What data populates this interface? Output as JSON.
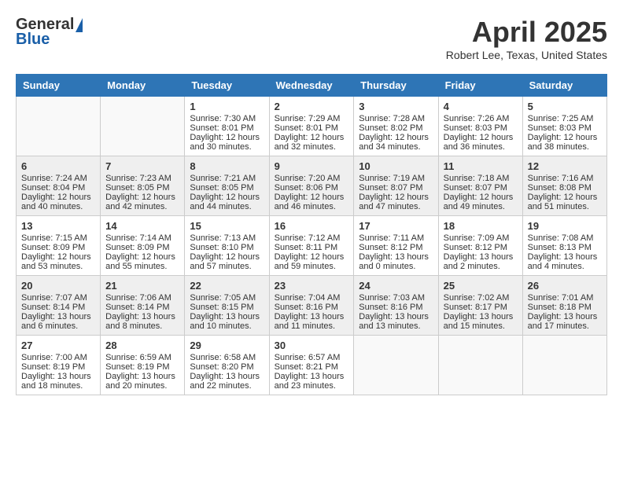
{
  "header": {
    "logo_general": "General",
    "logo_blue": "Blue",
    "month_title": "April 2025",
    "location": "Robert Lee, Texas, United States"
  },
  "days_of_week": [
    "Sunday",
    "Monday",
    "Tuesday",
    "Wednesday",
    "Thursday",
    "Friday",
    "Saturday"
  ],
  "weeks": [
    [
      {
        "day": "",
        "sunrise": "",
        "sunset": "",
        "daylight": ""
      },
      {
        "day": "",
        "sunrise": "",
        "sunset": "",
        "daylight": ""
      },
      {
        "day": "1",
        "sunrise": "Sunrise: 7:30 AM",
        "sunset": "Sunset: 8:01 PM",
        "daylight": "Daylight: 12 hours and 30 minutes."
      },
      {
        "day": "2",
        "sunrise": "Sunrise: 7:29 AM",
        "sunset": "Sunset: 8:01 PM",
        "daylight": "Daylight: 12 hours and 32 minutes."
      },
      {
        "day": "3",
        "sunrise": "Sunrise: 7:28 AM",
        "sunset": "Sunset: 8:02 PM",
        "daylight": "Daylight: 12 hours and 34 minutes."
      },
      {
        "day": "4",
        "sunrise": "Sunrise: 7:26 AM",
        "sunset": "Sunset: 8:03 PM",
        "daylight": "Daylight: 12 hours and 36 minutes."
      },
      {
        "day": "5",
        "sunrise": "Sunrise: 7:25 AM",
        "sunset": "Sunset: 8:03 PM",
        "daylight": "Daylight: 12 hours and 38 minutes."
      }
    ],
    [
      {
        "day": "6",
        "sunrise": "Sunrise: 7:24 AM",
        "sunset": "Sunset: 8:04 PM",
        "daylight": "Daylight: 12 hours and 40 minutes."
      },
      {
        "day": "7",
        "sunrise": "Sunrise: 7:23 AM",
        "sunset": "Sunset: 8:05 PM",
        "daylight": "Daylight: 12 hours and 42 minutes."
      },
      {
        "day": "8",
        "sunrise": "Sunrise: 7:21 AM",
        "sunset": "Sunset: 8:05 PM",
        "daylight": "Daylight: 12 hours and 44 minutes."
      },
      {
        "day": "9",
        "sunrise": "Sunrise: 7:20 AM",
        "sunset": "Sunset: 8:06 PM",
        "daylight": "Daylight: 12 hours and 46 minutes."
      },
      {
        "day": "10",
        "sunrise": "Sunrise: 7:19 AM",
        "sunset": "Sunset: 8:07 PM",
        "daylight": "Daylight: 12 hours and 47 minutes."
      },
      {
        "day": "11",
        "sunrise": "Sunrise: 7:18 AM",
        "sunset": "Sunset: 8:07 PM",
        "daylight": "Daylight: 12 hours and 49 minutes."
      },
      {
        "day": "12",
        "sunrise": "Sunrise: 7:16 AM",
        "sunset": "Sunset: 8:08 PM",
        "daylight": "Daylight: 12 hours and 51 minutes."
      }
    ],
    [
      {
        "day": "13",
        "sunrise": "Sunrise: 7:15 AM",
        "sunset": "Sunset: 8:09 PM",
        "daylight": "Daylight: 12 hours and 53 minutes."
      },
      {
        "day": "14",
        "sunrise": "Sunrise: 7:14 AM",
        "sunset": "Sunset: 8:09 PM",
        "daylight": "Daylight: 12 hours and 55 minutes."
      },
      {
        "day": "15",
        "sunrise": "Sunrise: 7:13 AM",
        "sunset": "Sunset: 8:10 PM",
        "daylight": "Daylight: 12 hours and 57 minutes."
      },
      {
        "day": "16",
        "sunrise": "Sunrise: 7:12 AM",
        "sunset": "Sunset: 8:11 PM",
        "daylight": "Daylight: 12 hours and 59 minutes."
      },
      {
        "day": "17",
        "sunrise": "Sunrise: 7:11 AM",
        "sunset": "Sunset: 8:12 PM",
        "daylight": "Daylight: 13 hours and 0 minutes."
      },
      {
        "day": "18",
        "sunrise": "Sunrise: 7:09 AM",
        "sunset": "Sunset: 8:12 PM",
        "daylight": "Daylight: 13 hours and 2 minutes."
      },
      {
        "day": "19",
        "sunrise": "Sunrise: 7:08 AM",
        "sunset": "Sunset: 8:13 PM",
        "daylight": "Daylight: 13 hours and 4 minutes."
      }
    ],
    [
      {
        "day": "20",
        "sunrise": "Sunrise: 7:07 AM",
        "sunset": "Sunset: 8:14 PM",
        "daylight": "Daylight: 13 hours and 6 minutes."
      },
      {
        "day": "21",
        "sunrise": "Sunrise: 7:06 AM",
        "sunset": "Sunset: 8:14 PM",
        "daylight": "Daylight: 13 hours and 8 minutes."
      },
      {
        "day": "22",
        "sunrise": "Sunrise: 7:05 AM",
        "sunset": "Sunset: 8:15 PM",
        "daylight": "Daylight: 13 hours and 10 minutes."
      },
      {
        "day": "23",
        "sunrise": "Sunrise: 7:04 AM",
        "sunset": "Sunset: 8:16 PM",
        "daylight": "Daylight: 13 hours and 11 minutes."
      },
      {
        "day": "24",
        "sunrise": "Sunrise: 7:03 AM",
        "sunset": "Sunset: 8:16 PM",
        "daylight": "Daylight: 13 hours and 13 minutes."
      },
      {
        "day": "25",
        "sunrise": "Sunrise: 7:02 AM",
        "sunset": "Sunset: 8:17 PM",
        "daylight": "Daylight: 13 hours and 15 minutes."
      },
      {
        "day": "26",
        "sunrise": "Sunrise: 7:01 AM",
        "sunset": "Sunset: 8:18 PM",
        "daylight": "Daylight: 13 hours and 17 minutes."
      }
    ],
    [
      {
        "day": "27",
        "sunrise": "Sunrise: 7:00 AM",
        "sunset": "Sunset: 8:19 PM",
        "daylight": "Daylight: 13 hours and 18 minutes."
      },
      {
        "day": "28",
        "sunrise": "Sunrise: 6:59 AM",
        "sunset": "Sunset: 8:19 PM",
        "daylight": "Daylight: 13 hours and 20 minutes."
      },
      {
        "day": "29",
        "sunrise": "Sunrise: 6:58 AM",
        "sunset": "Sunset: 8:20 PM",
        "daylight": "Daylight: 13 hours and 22 minutes."
      },
      {
        "day": "30",
        "sunrise": "Sunrise: 6:57 AM",
        "sunset": "Sunset: 8:21 PM",
        "daylight": "Daylight: 13 hours and 23 minutes."
      },
      {
        "day": "",
        "sunrise": "",
        "sunset": "",
        "daylight": ""
      },
      {
        "day": "",
        "sunrise": "",
        "sunset": "",
        "daylight": ""
      },
      {
        "day": "",
        "sunrise": "",
        "sunset": "",
        "daylight": ""
      }
    ]
  ]
}
